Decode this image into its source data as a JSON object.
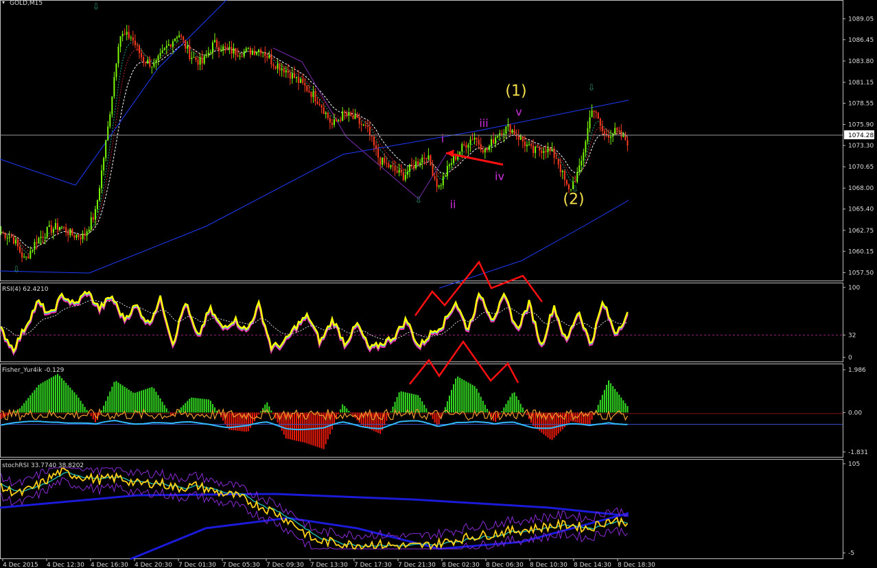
{
  "window": {
    "title": "GOLD,M15",
    "menu_icon": "triangle-down-icon"
  },
  "colors": {
    "background": "#000000",
    "grid_frame": "#c0c0c0",
    "bull_candle": "#7cfc00",
    "bear_candle": "#ff3b1f",
    "ma_blue": "#1e3cff",
    "ma_white": "#ffffff",
    "wave_label_yellow": "#f5e04b",
    "wave_label_magenta": "#d02ee0",
    "arrow_red": "#ff1010",
    "rsi_line": "#ffff00",
    "rsi_shadow_cyan": "#22d3ee",
    "rsi_shadow_magenta": "#ff2fa8",
    "fisher_pos": "#33dd22",
    "fisher_neg": "#ee1a0a",
    "fisher_line_orange": "#f0a030",
    "fisher_line_cyan": "#33bbff",
    "stoch_line_yellow": "#ffd21a",
    "stoch_ma_navy": "#1a1ad8",
    "stoch_band_purple": "#8a2bd8",
    "stoch_ma_teal": "#20b0a0"
  },
  "chart_data": [
    {
      "type": "candlestick",
      "panel": "price",
      "symbol": "GOLD",
      "timeframe": "M15",
      "ylim": [
        1056.85,
        1090.7
      ],
      "price_ticks": [
        "1089.05",
        "1086.45",
        "1083.80",
        "1081.15",
        "1078.55",
        "1075.90",
        "1073.30",
        "1070.65",
        "1068.00",
        "1065.40",
        "1062.75",
        "1060.15",
        "1057.50"
      ],
      "current_price": "1074.28",
      "x_labels": [
        "4 Dec 2015",
        "4 Dec 12:30",
        "4 Dec 16:30",
        "4 Dec 20:30",
        "7 Dec 01:30",
        "7 Dec 05:30",
        "7 Dec 09:30",
        "7 Dec 13:30",
        "7 Dec 17:30",
        "7 Dec 21:30",
        "8 Dec 02:30",
        "8 Dec 06:30",
        "8 Dec 10:30",
        "8 Dec 14:30",
        "8 Dec 18:30"
      ],
      "price_path": [
        1062.5,
        1061.8,
        1059.0,
        1061.5,
        1062.8,
        1063.3,
        1062.2,
        1062.0,
        1065.0,
        1075.0,
        1087.0,
        1086.8,
        1084.0,
        1083.2,
        1085.5,
        1087.3,
        1084.5,
        1083.5,
        1086.0,
        1085.2,
        1084.9,
        1085.0,
        1085.3,
        1083.6,
        1082.8,
        1081.5,
        1080.2,
        1078.6,
        1075.8,
        1077.2,
        1076.5,
        1075.2,
        1071.5,
        1070.5,
        1069.5,
        1071.0,
        1072.2,
        1068.0,
        1071.0,
        1073.0,
        1074.5,
        1072.5,
        1074.8,
        1075.6,
        1074.0,
        1072.5,
        1073.0,
        1071.8,
        1067.5,
        1070.5,
        1078.2,
        1074.6,
        1075.0,
        1073.8
      ],
      "wave_labels": [
        {
          "text": "(1)",
          "price": 1079.5,
          "color": "yellow"
        },
        {
          "text": "(2)",
          "price": 1066.0,
          "color": "yellow"
        },
        {
          "text": "i",
          "price": 1073.7,
          "color": "magenta"
        },
        {
          "text": "ii",
          "price": 1065.5,
          "color": "magenta"
        },
        {
          "text": "iii",
          "price": 1075.6,
          "color": "magenta"
        },
        {
          "text": "iv",
          "price": 1069.0,
          "color": "magenta"
        },
        {
          "text": "v",
          "price": 1077.0,
          "color": "magenta"
        }
      ]
    },
    {
      "type": "line",
      "panel": "rsi",
      "title": "RSI(4) 62.4210",
      "ylim": [
        0,
        100
      ],
      "y_ticks": [
        "100",
        "32",
        "0"
      ],
      "level": 32,
      "values": [
        40,
        12,
        45,
        80,
        60,
        90,
        75,
        95,
        70,
        88,
        55,
        75,
        48,
        85,
        20,
        80,
        28,
        70,
        42,
        55,
        38,
        76,
        15,
        20,
        45,
        60,
        22,
        55,
        20,
        48,
        12,
        20,
        30,
        55,
        15,
        35,
        48,
        80,
        40,
        92,
        55,
        88,
        40,
        78,
        16,
        75,
        22,
        68,
        18,
        80,
        35,
        62
      ]
    },
    {
      "type": "bar",
      "panel": "fisher",
      "title": "Fisher_Yur4ik -0.129",
      "ylim": [
        -1.9,
        2.05
      ],
      "y_ticks": [
        "1.986",
        "0.00",
        "-1.831"
      ],
      "values": [
        -0.3,
        0.2,
        1.3,
        1.8,
        0.8,
        -0.5,
        1.5,
        0.9,
        1.2,
        -0.2,
        0.7,
        0.6,
        -0.8,
        -0.9,
        0.5,
        -1.2,
        -1.4,
        -1.7,
        0.4,
        -0.6,
        -1.0,
        1.0,
        0.8,
        -0.7,
        1.7,
        1.2,
        -0.5,
        1.0,
        -0.6,
        -1.3,
        -0.4,
        -0.6,
        1.5,
        0.3
      ]
    },
    {
      "type": "line",
      "panel": "stochrsi",
      "title": "stochRSI 33.7740 38.8202",
      "ylim": [
        -5,
        105
      ],
      "y_ticks": [
        "105",
        "-5"
      ],
      "values": [
        75,
        68,
        80,
        95,
        90,
        85,
        88,
        80,
        82,
        75,
        78,
        70,
        65,
        55,
        45,
        30,
        10,
        8,
        5,
        6,
        4,
        3,
        5,
        10,
        15,
        18,
        22,
        24,
        28,
        30,
        25,
        35,
        33.8
      ]
    }
  ]
}
